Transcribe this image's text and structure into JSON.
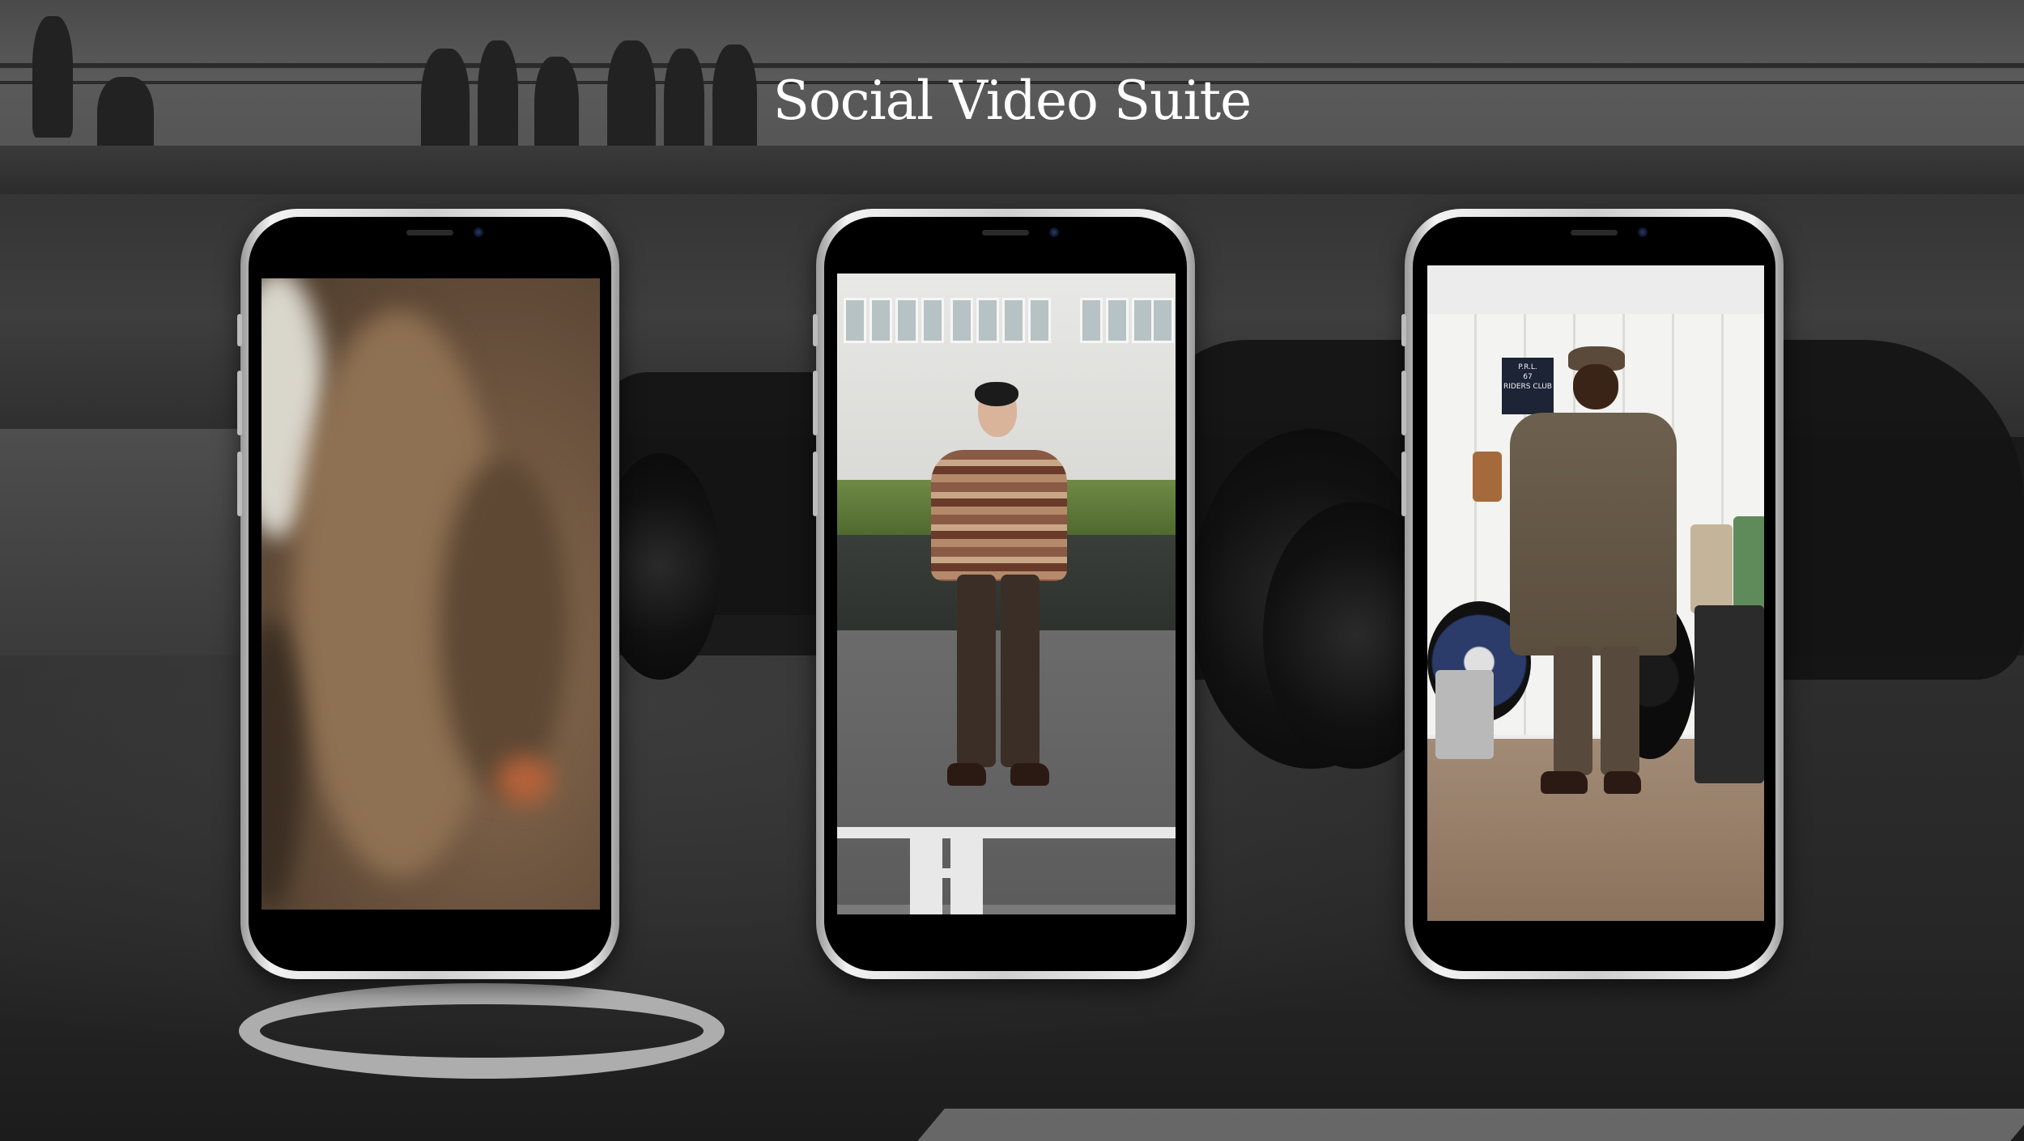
{
  "page": {
    "title": "Social Video Suite"
  },
  "phones": [
    {
      "id": "phone-1",
      "content": "blurred-brown-coat-video-frame"
    },
    {
      "id": "phone-2",
      "content": "man-in-fair-isle-sweater-video-frame"
    },
    {
      "id": "phone-3",
      "content": "man-in-garage-video-frame"
    }
  ],
  "phone3_sign": {
    "line1": "P.R.L.",
    "line2": "67",
    "line3": "RIDERS CLUB"
  },
  "colors": {
    "title_text": "#ffffff",
    "phone_frame": "#e6e6e6",
    "phone_body": "#000000",
    "background": "#2a2a2a"
  }
}
